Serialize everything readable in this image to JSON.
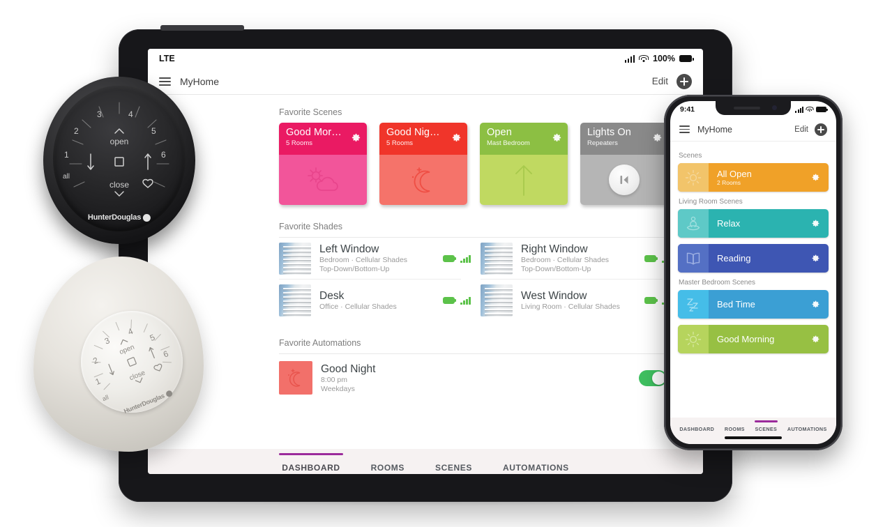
{
  "tablet": {
    "status_bar": {
      "carrier": "LTE",
      "battery_text": "100%"
    },
    "nav": {
      "title": "MyHome",
      "edit_label": "Edit"
    },
    "sections": {
      "scenes_label": "Favorite Scenes",
      "shades_label": "Favorite Shades",
      "automations_label": "Favorite Automations"
    },
    "scenes": [
      {
        "name": "Good Mor…",
        "subtitle": "5 Rooms",
        "header_color": "#ea1a63",
        "body_color": "#f2559a",
        "icon": "sun-cloud-icon"
      },
      {
        "name": "Good Nig…",
        "subtitle": "5 Rooms",
        "header_color": "#f0352a",
        "body_color": "#f5736a",
        "icon": "moon-stars-icon"
      },
      {
        "name": "Open",
        "subtitle": "Mast Bedroom",
        "header_color": "#8cbf43",
        "body_color": "#c0d961",
        "icon": "arrow-up-icon"
      },
      {
        "name": "Lights On",
        "subtitle": "Repeaters",
        "header_color": "#8a8a8a",
        "body_color": "#b5b5b5",
        "icon": "repeater-icon"
      }
    ],
    "shades": [
      {
        "title": "Left Window",
        "meta1": "Bedroom · Cellular Shades",
        "meta2": "Top-Down/Bottom-Up"
      },
      {
        "title": "Right Window",
        "meta1": "Bedroom · Cellular Shades",
        "meta2": "Top-Down/Bottom-Up"
      },
      {
        "title": "Desk",
        "meta1": "Office · Cellular Shades",
        "meta2": ""
      },
      {
        "title": "West Window",
        "meta1": "Living Room · Cellular Shades",
        "meta2": ""
      }
    ],
    "automation": {
      "title": "Good Night",
      "time": "8:00 pm",
      "days": "Weekdays",
      "icon": "moon-stars-icon",
      "thumb_color": "#f2706a",
      "toggle_on": true
    },
    "tabs": [
      {
        "label": "DASHBOARD",
        "active": true
      },
      {
        "label": "ROOMS",
        "active": false
      },
      {
        "label": "SCENES",
        "active": false
      },
      {
        "label": "AUTOMATIONS",
        "active": false
      }
    ]
  },
  "phone": {
    "status_bar": {
      "time": "9:41"
    },
    "nav": {
      "title": "MyHome",
      "edit_label": "Edit"
    },
    "groups": [
      {
        "label": "Scenes",
        "scenes": [
          {
            "name": "All Open",
            "subtitle": "2 Rooms",
            "art_color": "#f2c46a",
            "body_color": "#f0a128",
            "icon": "sun-icon"
          }
        ]
      },
      {
        "label": "Living Room Scenes",
        "scenes": [
          {
            "name": "Relax",
            "subtitle": "",
            "art_color": "#5ec9c7",
            "body_color": "#2bb3b0",
            "icon": "meditation-icon"
          },
          {
            "name": "Reading",
            "subtitle": "",
            "art_color": "#5470c4",
            "body_color": "#3e56b3",
            "icon": "open-book-icon"
          }
        ]
      },
      {
        "label": "Master Bedroom Scenes",
        "scenes": [
          {
            "name": "Bed Time",
            "subtitle": "",
            "art_color": "#45bde8",
            "body_color": "#3b9fd4",
            "icon": "zzz-icon"
          },
          {
            "name": "Good Morning",
            "subtitle": "",
            "art_color": "#b6d45d",
            "body_color": "#97c043",
            "icon": "sun-icon"
          }
        ]
      }
    ],
    "tabs": [
      {
        "label": "DASHBOARD",
        "active": false
      },
      {
        "label": "ROOMS",
        "active": false
      },
      {
        "label": "SCENES",
        "active": true
      },
      {
        "label": "AUTOMATIONS",
        "active": false
      }
    ]
  },
  "remotes": [
    {
      "id": "dark-remote",
      "brand": "HunterDouglas",
      "numbers": [
        "1",
        "2",
        "3",
        "4",
        "5",
        "6"
      ],
      "labels": {
        "open": "open",
        "close": "close",
        "all": "all"
      }
    },
    {
      "id": "light-remote",
      "brand": "HunterDouglas",
      "numbers": [
        "1",
        "2",
        "3",
        "4",
        "5",
        "6"
      ],
      "labels": {
        "open": "open",
        "close": "close",
        "all": "all"
      }
    }
  ],
  "theme": {
    "accent": "#9b2b9b",
    "tab_bg": "#f6f2f2",
    "green": "#5cc24a",
    "toggle_on": "#3fc060"
  }
}
